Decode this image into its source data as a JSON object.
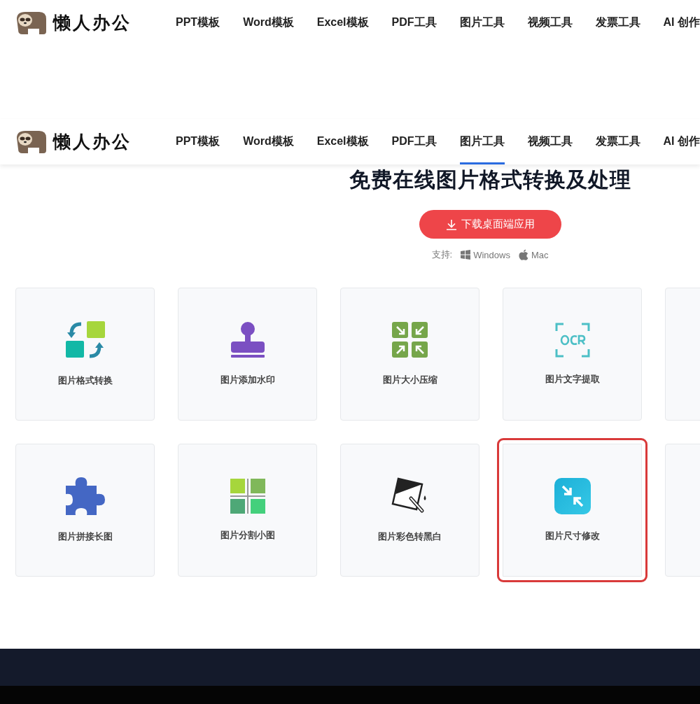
{
  "headers": [
    {
      "logo": "懒人办公",
      "nav": [
        {
          "label": "PPT模板",
          "selected": false
        },
        {
          "label": "Word模板",
          "selected": false
        },
        {
          "label": "Excel模板",
          "selected": false
        },
        {
          "label": "PDF工具",
          "selected": false
        },
        {
          "label": "图片工具",
          "selected": false
        },
        {
          "label": "视频工具",
          "selected": false
        },
        {
          "label": "发票工具",
          "selected": false
        },
        {
          "label": "AI 创作",
          "selected": false
        }
      ]
    },
    {
      "logo": "懒人办公",
      "nav": [
        {
          "label": "PPT模板",
          "selected": false
        },
        {
          "label": "Word模板",
          "selected": false
        },
        {
          "label": "Excel模板",
          "selected": false
        },
        {
          "label": "PDF工具",
          "selected": false
        },
        {
          "label": "图片工具",
          "selected": true
        },
        {
          "label": "视频工具",
          "selected": false
        },
        {
          "label": "发票工具",
          "selected": false
        },
        {
          "label": "AI 创作",
          "selected": false
        }
      ]
    }
  ],
  "hero": {
    "title": "免费在线图片格式转换及处理",
    "download_button": "下载桌面端应用",
    "support_label": "支持:",
    "platforms": [
      {
        "kind": "windows",
        "label": "Windows"
      },
      {
        "kind": "mac",
        "label": "Mac"
      }
    ]
  },
  "tool_rows": [
    [
      {
        "kind": "convert",
        "label": "图片格式转换",
        "highlighted": false
      },
      {
        "kind": "stamp",
        "label": "图片添加水印",
        "highlighted": false
      },
      {
        "kind": "compress",
        "label": "图片大小压缩",
        "highlighted": false
      },
      {
        "kind": "ocr",
        "label": "图片文字提取",
        "highlighted": false
      },
      {
        "kind": "blank",
        "highlighted": false
      }
    ],
    [
      {
        "kind": "puzzle",
        "label": "图片拼接长图",
        "highlighted": false
      },
      {
        "kind": "split",
        "label": "图片分割小图",
        "highlighted": false
      },
      {
        "kind": "grayscale",
        "label": "图片彩色转黑白",
        "highlighted": false
      },
      {
        "kind": "resize",
        "label": "图片尺寸修改",
        "highlighted": true
      },
      {
        "kind": "blank",
        "highlighted": false
      }
    ]
  ]
}
